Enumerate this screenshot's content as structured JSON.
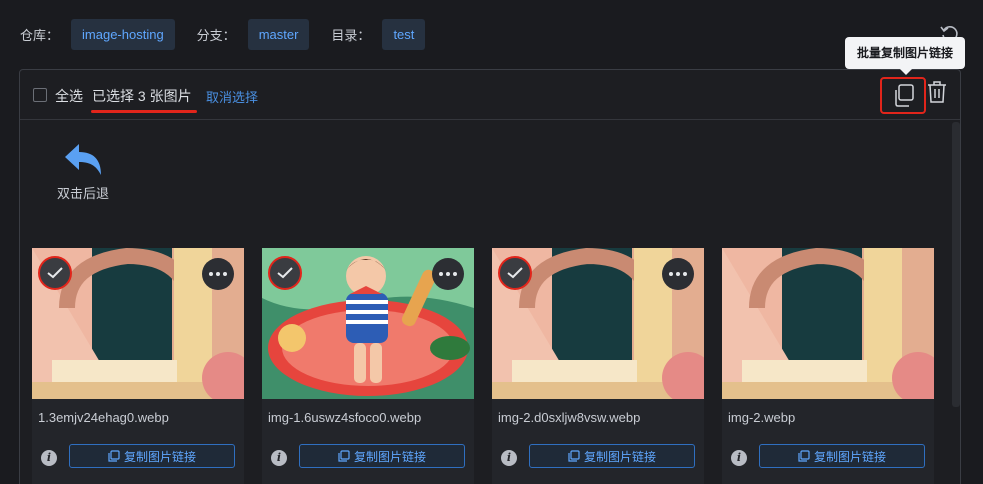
{
  "topbar": {
    "repo_label": "仓库：",
    "repo_value": "image-hosting",
    "branch_label": "分支：",
    "branch_value": "master",
    "dir_label": "目录：",
    "dir_value": "test"
  },
  "tooltip": "批量复制图片链接",
  "toolbar": {
    "select_all": "全选",
    "selected_text": "已选择 3 张图片",
    "cancel": "取消选择"
  },
  "back_label": "双击后退",
  "cards": [
    {
      "filename": "1.3emjv24ehag0.webp",
      "copy_label": "复制图片链接",
      "selected": true
    },
    {
      "filename": "img-1.6uswz4sfoco0.webp",
      "copy_label": "复制图片链接",
      "selected": true
    },
    {
      "filename": "img-2.d0sxljw8vsw.webp",
      "copy_label": "复制图片链接",
      "selected": true
    },
    {
      "filename": "img-2.webp",
      "copy_label": "复制图片链接",
      "selected": false
    }
  ],
  "colors": {
    "accent": "#4a90e2",
    "highlight": "#e1251b",
    "background": "#1a1b1f"
  },
  "icons": [
    "refresh-icon",
    "copy-icon",
    "trash-icon",
    "back-arrow-icon",
    "check-icon",
    "more-icon",
    "info-icon"
  ]
}
